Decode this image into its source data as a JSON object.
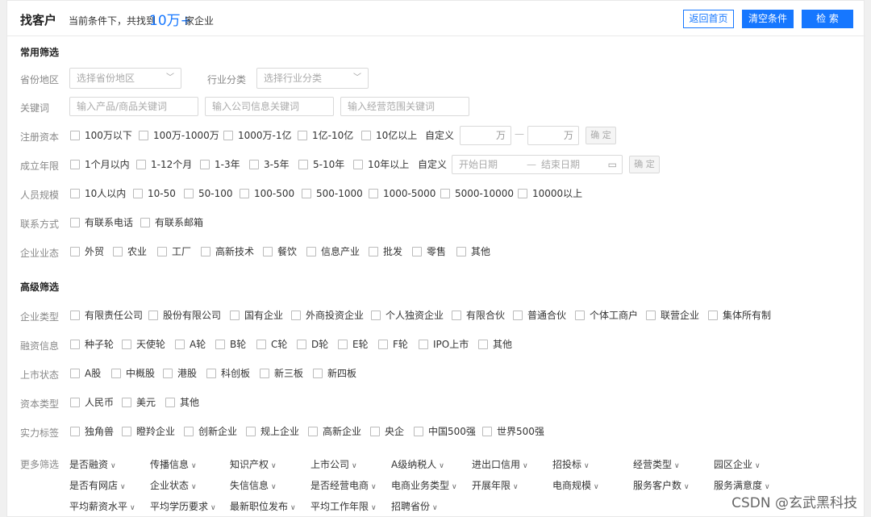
{
  "header": {
    "title": "找客户",
    "sub_prefix": "当前条件下，共找到",
    "count": "10万+",
    "sub_suffix": "家企业",
    "btn_home": "返回首页",
    "btn_clear": "清空条件",
    "btn_search": "检 索"
  },
  "common": {
    "section_title": "常用筛选",
    "region_label": "省份地区",
    "region_placeholder": "选择省份地区",
    "industry_label": "行业分类",
    "industry_placeholder": "选择行业分类",
    "keyword_label": "关键词",
    "kw_product": "输入产品/商品关键词",
    "kw_company": "输入公司信息关键词",
    "kw_scope": "输入经营范围关键词",
    "capital_label": "注册资本",
    "capital_opts": [
      "100万以下",
      "100万-1000万",
      "1000万-1亿",
      "1亿-10亿",
      "10亿以上"
    ],
    "custom": "自定义",
    "unit_wan": "万",
    "confirm": "确 定",
    "founded_label": "成立年限",
    "founded_opts": [
      "1个月以内",
      "1-12个月",
      "1-3年",
      "3-5年",
      "5-10年",
      "10年以上"
    ],
    "start_date": "开始日期",
    "end_date": "结束日期",
    "staff_label": "人员规模",
    "staff_opts": [
      "10人以内",
      "10-50",
      "50-100",
      "100-500",
      "500-1000",
      "1000-5000",
      "5000-10000",
      "10000以上"
    ],
    "contact_label": "联系方式",
    "contact_opts": [
      "有联系电话",
      "有联系邮箱"
    ],
    "biz_label": "企业业态",
    "biz_opts": [
      "外贸",
      "农业",
      "工厂",
      "高新技术",
      "餐饮",
      "信息产业",
      "批发",
      "零售",
      "其他"
    ]
  },
  "advanced": {
    "section_title": "高级筛选",
    "type_label": "企业类型",
    "type_opts": [
      "有限责任公司",
      "股份有限公司",
      "国有企业",
      "外商投资企业",
      "个人独资企业",
      "有限合伙",
      "普通合伙",
      "个体工商户",
      "联营企业",
      "集体所有制"
    ],
    "finance_label": "融资信息",
    "finance_opts": [
      "种子轮",
      "天使轮",
      "A轮",
      "B轮",
      "C轮",
      "D轮",
      "E轮",
      "F轮",
      "IPO上市",
      "其他"
    ],
    "listing_label": "上市状态",
    "listing_opts": [
      "A股",
      "中概股",
      "港股",
      "科创板",
      "新三板",
      "新四板"
    ],
    "capital_type_label": "资本类型",
    "capital_type_opts": [
      "人民币",
      "美元",
      "其他"
    ],
    "strength_label": "实力标签",
    "strength_opts": [
      "独角兽",
      "瞪羚企业",
      "创新企业",
      "规上企业",
      "高新企业",
      "央企",
      "中国500强",
      "世界500强"
    ],
    "more_label": "更多筛选",
    "more_row1": [
      "是否融资",
      "传播信息",
      "知识产权",
      "上市公司",
      "A级纳税人",
      "进出口信用",
      "招投标",
      "经营类型",
      "园区企业"
    ],
    "more_row2": [
      "是否有网店",
      "企业状态",
      "失信信息",
      "是否经营电商",
      "电商业务类型",
      "开展年限",
      "电商规模",
      "服务客户数",
      "服务满意度"
    ],
    "more_row3": [
      "平均薪资水平",
      "平均学历要求",
      "最新职位发布",
      "平均工作年限",
      "招聘省份"
    ]
  },
  "watermark": "CSDN @玄武黑科技"
}
